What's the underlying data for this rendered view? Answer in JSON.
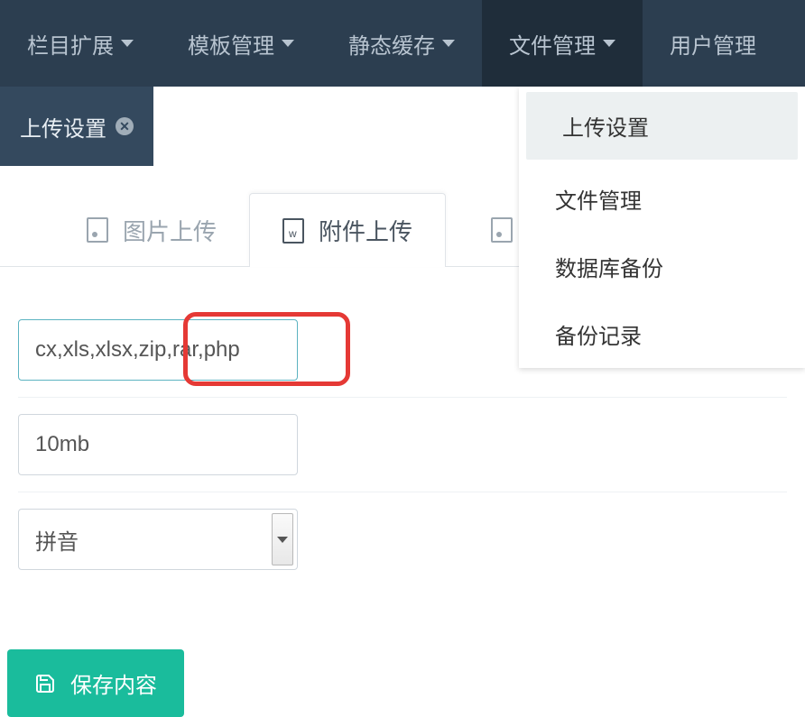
{
  "nav": {
    "items": [
      {
        "label": "栏目扩展"
      },
      {
        "label": "模板管理"
      },
      {
        "label": "静态缓存"
      },
      {
        "label": "文件管理"
      },
      {
        "label": "用户管理"
      }
    ]
  },
  "subnav": {
    "tab_label": "上传设置"
  },
  "dropdown": {
    "items": [
      {
        "label": "上传设置"
      },
      {
        "label": "文件管理"
      },
      {
        "label": "数据库备份"
      },
      {
        "label": "备份记录"
      }
    ]
  },
  "file_tabs": {
    "image": "图片上传",
    "attachment": "附件上传"
  },
  "form": {
    "extensions": "cx,xls,xlsx,zip,rar,php",
    "size": "10mb",
    "naming": "拼音"
  },
  "buttons": {
    "save": "保存内容"
  }
}
